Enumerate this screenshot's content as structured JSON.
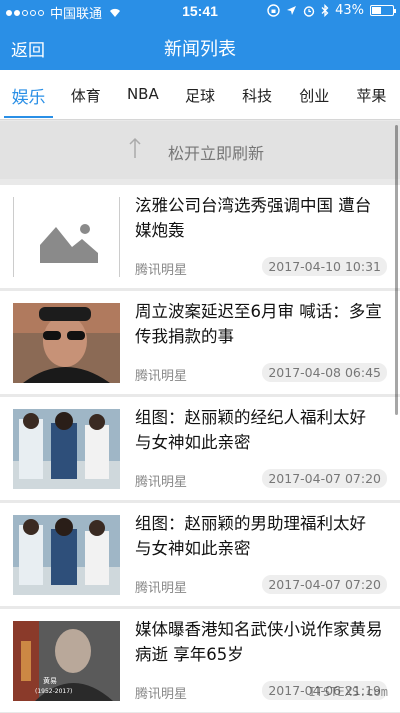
{
  "status_bar": {
    "carrier": "中国联通",
    "time": "15:41",
    "battery": "43%",
    "battery_level": 0.43,
    "signal_dots_filled": 2,
    "signal_dots_total": 5,
    "icons": [
      "wifi-icon",
      "lock-rotation-icon",
      "location-icon",
      "alarm-icon",
      "bluetooth-icon",
      "battery-icon"
    ]
  },
  "nav": {
    "back_label": "返回",
    "title": "新闻列表"
  },
  "tabs": [
    {
      "label": "娱乐",
      "active": true
    },
    {
      "label": "体育",
      "active": false
    },
    {
      "label": "NBA",
      "active": false
    },
    {
      "label": "足球",
      "active": false
    },
    {
      "label": "科技",
      "active": false
    },
    {
      "label": "创业",
      "active": false
    },
    {
      "label": "苹果",
      "active": false
    }
  ],
  "refresh": {
    "label": "松开立即刷新"
  },
  "news": [
    {
      "title": "泫雅公司台湾选秀强调中国 遭台媒炮轰",
      "source": "腾讯明星",
      "date": "2017-04-10 10:31",
      "thumb": "placeholder"
    },
    {
      "title": "周立波案延迟至6月审 喊话：多宣传我捐款的事",
      "source": "腾讯明星",
      "date": "2017-04-08 06:45",
      "thumb": "portrait-sunglasses"
    },
    {
      "title": "组图：赵丽颖的经纪人福利太好 与女神如此亲密",
      "source": "腾讯明星",
      "date": "2017-04-07 07:20",
      "thumb": "group-photo"
    },
    {
      "title": "组图：赵丽颖的男助理福利太好 与女神如此亲密",
      "source": "腾讯明星",
      "date": "2017-04-07 07:20",
      "thumb": "group-photo"
    },
    {
      "title": "媒体曝香港知名武侠小说作家黄易病逝 享年65岁",
      "source": "腾讯明星",
      "date": "2017-04-06 21:19",
      "thumb": "portrait-bald",
      "thumb_text": "黄易\n(1952-2017)"
    }
  ],
  "watermark": "ITSTEXS.com",
  "colors": {
    "accent": "#2a8fe6",
    "list_bg": "#e9e9e9"
  }
}
